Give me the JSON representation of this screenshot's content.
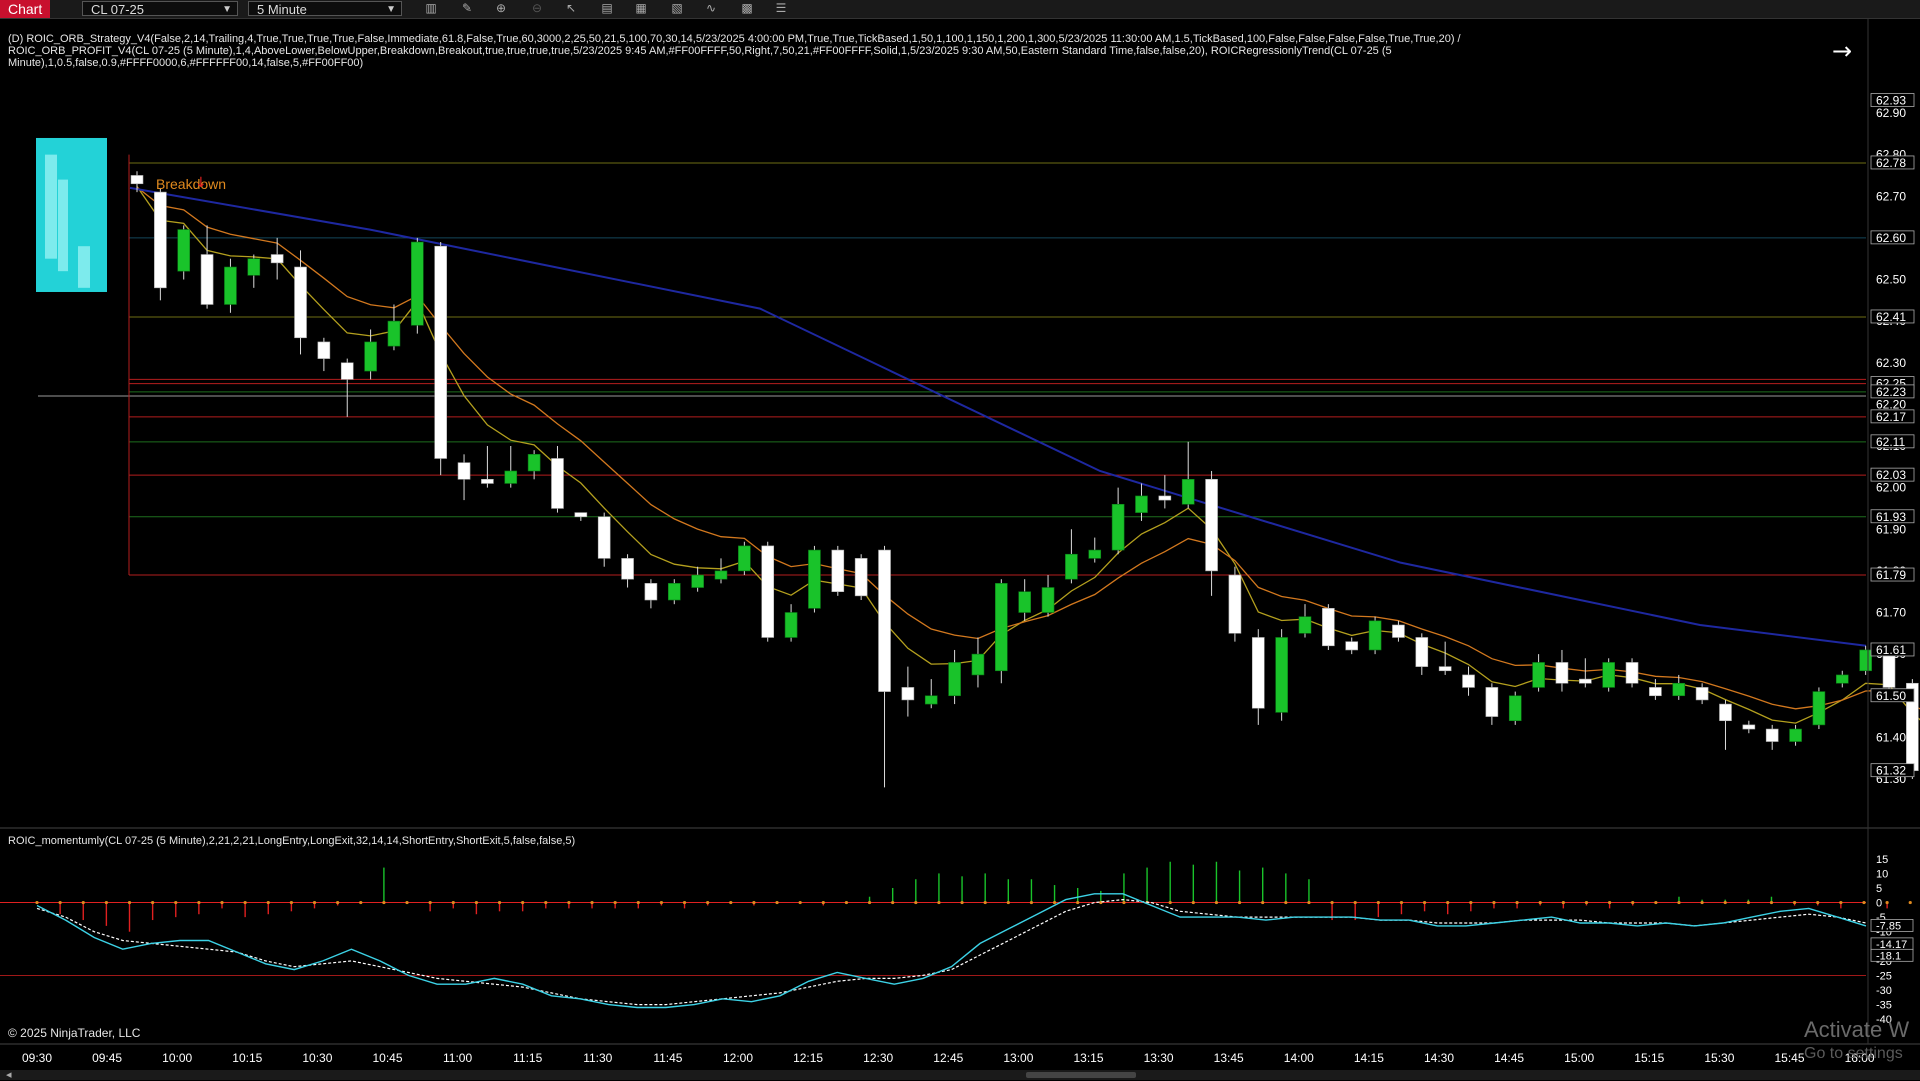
{
  "toolbar": {
    "chart_tab": "Chart",
    "instrument": "CL 07-25",
    "interval": "5 Minute",
    "icons": [
      "bar-style-icon",
      "draw-pencil-icon",
      "zoom-in-icon",
      "zoom-out-icon",
      "pointer-icon",
      "properties-icon",
      "data-box-icon",
      "strategies-icon",
      "indicators-icon",
      "templates-icon"
    ]
  },
  "header": {
    "strategy_line1": "(D) ROIC_ORB_Strategy_V4(False,2,14,Trailing,4,True,True,True,True,False,Immediate,61.8,False,True,60,3000,2,25,50,21,5,100,70,30,14,5/23/2025 4:00:00 PM,True,True,TickBased,1,50,1,100,1,150,1,200,1,300,5/23/2025 11:30:00 AM,1.5,TickBased,100,False,False,False,False,True,True,20) /",
    "strategy_line2": "ROIC_ORB_PROFIT_V4(CL 07-25 (5 Minute),1,4,AboveLower,BelowUpper,Breakdown,Breakout,true,true,true,true,5/23/2025 9:45 AM,#FF00FFFF,50,Right,7,50,21,#FF00FFFF,Solid,1,5/23/2025 9:30 AM,50,Eastern Standard Time,false,false,20), ROICRegressionlyTrend(CL 07-25 (5",
    "strategy_line3": "Minute),1,0.5,false,0.9,#FFFF0000,6,#FFFFFF00,14,false,5,#FF00FF00)",
    "breakdown_label": "Breakdown",
    "indicator_label": "ROIC_momentumly(CL 07-25 (5 Minute),2,21,2,21,LongEntry,LongExit,32,14,14,ShortEntry,ShortExit,5,false,false,5)",
    "copyright": "© 2025 NinjaTrader, LLC",
    "watermark_line1": "Activate W",
    "watermark_line2": "Go to settings"
  },
  "colors": {
    "up_candle": "#19c32a",
    "down_candle": "#ffffff",
    "ema_fast": "#b4a01e",
    "ema_slow": "#d2781e",
    "trend": "#1e28a0",
    "cyan_box": "#23d2d7",
    "red_line": "#b41e1e",
    "green_line": "#1e6e1e",
    "yellow_line": "#6e6e14",
    "osc_fast": "#3cd2e6",
    "osc_slow": "#ffffff"
  },
  "chart_data": {
    "type": "candlestick",
    "instrument": "CL 07-25 (5 Minute)",
    "price_axis_ticks": [
      "62.90",
      "62.80",
      "62.70",
      "62.60",
      "62.50",
      "62.40",
      "62.30",
      "62.20",
      "62.10",
      "62.00",
      "61.90",
      "61.80",
      "61.70",
      "61.60",
      "61.50",
      "61.40",
      "61.30"
    ],
    "price_badges": [
      {
        "label": "62.93",
        "color": "#ffffff"
      },
      {
        "label": "62.78",
        "color": "#ffffff"
      },
      {
        "label": "62.60",
        "color": "#ffffff"
      },
      {
        "label": "62.41",
        "color": "#ffffff"
      },
      {
        "label": "62.25",
        "color": "#ffffff"
      },
      {
        "label": "62.23",
        "color": "#ffffff"
      },
      {
        "label": "62.17",
        "color": "#ffffff"
      },
      {
        "label": "62.11",
        "color": "#ffffff"
      },
      {
        "label": "62.03",
        "color": "#ffffff"
      },
      {
        "label": "61.93",
        "color": "#ffffff"
      },
      {
        "label": "61.79",
        "color": "#ffffff"
      },
      {
        "label": "61.61",
        "color": "#ffffff"
      },
      {
        "label": "61.50",
        "color": "#ffffff"
      },
      {
        "label": "61.32",
        "color": "#ffffff"
      }
    ],
    "levels": [
      {
        "price": 62.78,
        "color": "#6e6e14"
      },
      {
        "price": 62.6,
        "color": "#14465a"
      },
      {
        "price": 62.41,
        "color": "#6e6e14"
      },
      {
        "price": 62.26,
        "color": "#b41e1e"
      },
      {
        "price": 62.25,
        "color": "#b41e1e"
      },
      {
        "price": 62.23,
        "color": "#1e6e1e"
      },
      {
        "price": 62.17,
        "color": "#b41e1e"
      },
      {
        "price": 62.11,
        "color": "#1e6e1e"
      },
      {
        "price": 62.03,
        "color": "#b41e1e"
      },
      {
        "price": 61.93,
        "color": "#1e6e1e"
      },
      {
        "price": 61.79,
        "color": "#b41e1e"
      }
    ],
    "time_labels": [
      "09:30",
      "09:45",
      "10:00",
      "10:15",
      "10:30",
      "10:45",
      "11:00",
      "11:15",
      "11:30",
      "11:45",
      "12:00",
      "12:15",
      "12:30",
      "12:45",
      "13:00",
      "13:15",
      "13:30",
      "13:45",
      "14:00",
      "14:15",
      "14:30",
      "14:45",
      "15:00",
      "15:15",
      "15:30",
      "15:45",
      "16:00"
    ],
    "candles": [
      [
        62.75,
        62.73,
        62.76,
        62.71
      ],
      [
        62.71,
        62.48,
        62.72,
        62.45
      ],
      [
        62.52,
        62.62,
        62.63,
        62.5
      ],
      [
        62.56,
        62.44,
        62.63,
        62.43
      ],
      [
        62.44,
        62.53,
        62.55,
        62.42
      ],
      [
        62.51,
        62.55,
        62.56,
        62.48
      ],
      [
        62.56,
        62.54,
        62.6,
        62.5
      ],
      [
        62.53,
        62.36,
        62.57,
        62.32
      ],
      [
        62.35,
        62.31,
        62.36,
        62.28
      ],
      [
        62.3,
        62.26,
        62.31,
        62.17
      ],
      [
        62.28,
        62.35,
        62.38,
        62.26
      ],
      [
        62.34,
        62.4,
        62.44,
        62.33
      ],
      [
        62.39,
        62.59,
        62.6,
        62.37
      ],
      [
        62.58,
        62.07,
        62.59,
        62.03
      ],
      [
        62.06,
        62.02,
        62.08,
        61.97
      ],
      [
        62.02,
        62.01,
        62.1,
        62.0
      ],
      [
        62.01,
        62.04,
        62.1,
        62.0
      ],
      [
        62.04,
        62.08,
        62.09,
        62.02
      ],
      [
        62.07,
        61.95,
        62.1,
        61.94
      ],
      [
        61.94,
        61.93,
        61.94,
        61.92
      ],
      [
        61.93,
        61.83,
        61.94,
        61.81
      ],
      [
        61.83,
        61.78,
        61.84,
        61.76
      ],
      [
        61.77,
        61.73,
        61.78,
        61.71
      ],
      [
        61.73,
        61.77,
        61.78,
        61.72
      ],
      [
        61.76,
        61.79,
        61.81,
        61.75
      ],
      [
        61.78,
        61.8,
        61.83,
        61.77
      ],
      [
        61.8,
        61.86,
        61.87,
        61.79
      ],
      [
        61.86,
        61.64,
        61.87,
        61.63
      ],
      [
        61.64,
        61.7,
        61.72,
        61.63
      ],
      [
        61.71,
        61.85,
        61.86,
        61.7
      ],
      [
        61.85,
        61.75,
        61.86,
        61.74
      ],
      [
        61.83,
        61.74,
        61.84,
        61.73
      ],
      [
        61.85,
        61.51,
        61.86,
        61.28
      ],
      [
        61.52,
        61.49,
        61.57,
        61.45
      ],
      [
        61.48,
        61.5,
        61.54,
        61.47
      ],
      [
        61.5,
        61.58,
        61.61,
        61.48
      ],
      [
        61.55,
        61.6,
        61.64,
        61.52
      ],
      [
        61.56,
        61.77,
        61.78,
        61.53
      ],
      [
        61.7,
        61.75,
        61.78,
        61.68
      ],
      [
        61.7,
        61.76,
        61.79,
        61.69
      ],
      [
        61.78,
        61.84,
        61.9,
        61.77
      ],
      [
        61.83,
        61.85,
        61.88,
        61.82
      ],
      [
        61.85,
        61.96,
        62.0,
        61.84
      ],
      [
        61.94,
        61.98,
        62.01,
        61.92
      ],
      [
        61.98,
        61.97,
        62.03,
        61.95
      ],
      [
        61.96,
        62.02,
        62.11,
        61.95
      ],
      [
        62.02,
        61.8,
        62.04,
        61.74
      ],
      [
        61.79,
        61.65,
        61.81,
        61.63
      ],
      [
        61.64,
        61.47,
        61.66,
        61.43
      ],
      [
        61.46,
        61.64,
        61.66,
        61.44
      ],
      [
        61.65,
        61.69,
        61.72,
        61.64
      ],
      [
        61.71,
        61.62,
        61.72,
        61.61
      ],
      [
        61.63,
        61.61,
        61.64,
        61.6
      ],
      [
        61.61,
        61.68,
        61.69,
        61.6
      ],
      [
        61.67,
        61.64,
        61.68,
        61.63
      ],
      [
        61.64,
        61.57,
        61.65,
        61.55
      ],
      [
        61.57,
        61.56,
        61.63,
        61.55
      ],
      [
        61.55,
        61.52,
        61.57,
        61.5
      ],
      [
        61.52,
        61.45,
        61.53,
        61.43
      ],
      [
        61.44,
        61.5,
        61.51,
        61.43
      ],
      [
        61.52,
        61.58,
        61.6,
        61.51
      ],
      [
        61.58,
        61.53,
        61.61,
        61.51
      ],
      [
        61.54,
        61.53,
        61.59,
        61.52
      ],
      [
        61.52,
        61.58,
        61.59,
        61.51
      ],
      [
        61.58,
        61.53,
        61.59,
        61.52
      ],
      [
        61.52,
        61.5,
        61.54,
        61.49
      ],
      [
        61.5,
        61.53,
        61.55,
        61.49
      ],
      [
        61.52,
        61.49,
        61.53,
        61.48
      ],
      [
        61.48,
        61.44,
        61.49,
        61.37
      ],
      [
        61.43,
        61.42,
        61.44,
        61.41
      ],
      [
        61.42,
        61.39,
        61.43,
        61.37
      ],
      [
        61.39,
        61.42,
        61.43,
        61.38
      ],
      [
        61.43,
        61.51,
        61.52,
        61.42
      ],
      [
        61.53,
        61.55,
        61.56,
        61.52
      ],
      [
        61.56,
        61.61,
        61.62,
        61.55
      ],
      [
        61.61,
        61.52,
        61.62,
        61.51
      ],
      [
        61.53,
        61.32,
        61.54,
        61.3
      ],
      [
        61.32,
        61.32,
        61.34,
        61.31
      ]
    ],
    "oscillator": {
      "axis_labels": [
        "15",
        "10",
        "5",
        "0",
        "-5",
        "-10",
        "-15",
        "-20",
        "-25",
        "-30",
        "-35",
        "-40"
      ],
      "badges": [
        "-7.85",
        "-14.17",
        "-18.1"
      ],
      "histogram": [
        0,
        -4,
        -6,
        -8,
        -10,
        -6,
        -5,
        -4,
        -2,
        -5,
        -4,
        -3,
        -2,
        -1,
        0,
        12,
        0,
        -3,
        -2,
        -4,
        -3,
        -3,
        -2,
        -2,
        -2,
        -2,
        -2,
        -1,
        -2,
        -1,
        0,
        -1,
        0,
        0,
        -1,
        0,
        2,
        5,
        8,
        10,
        9,
        10,
        8,
        8,
        6,
        5,
        4,
        10,
        12,
        14,
        13,
        14,
        11,
        12,
        10,
        8,
        -6,
        -6,
        -5,
        -4,
        -3,
        -4,
        -3,
        -2,
        -2,
        -1,
        -2,
        -1,
        -2,
        -1,
        0,
        2,
        1,
        1,
        1,
        2,
        -1,
        -1,
        -2,
        0,
        -2,
        0,
        -1,
        -2,
        0,
        4,
        6,
        8,
        5,
        2,
        -3,
        -5
      ],
      "fast_line": [
        -1,
        -6,
        -12,
        -16,
        -14,
        -13,
        -13,
        -17,
        -21,
        -23,
        -20,
        -16,
        -20,
        -25,
        -28,
        -28,
        -26,
        -28,
        -32,
        -33,
        -35,
        -36,
        -36,
        -35,
        -33,
        -34,
        -32,
        -27,
        -24,
        -26,
        -28,
        -26,
        -22,
        -14,
        -9,
        -4,
        1,
        3,
        3,
        -1,
        -5,
        -5,
        -5,
        -6,
        -5,
        -5,
        -5,
        -6,
        -6,
        -8,
        -8,
        -7,
        -6,
        -5,
        -7,
        -7,
        -8,
        -7,
        -8,
        -7,
        -5,
        -3,
        -2,
        -5,
        -8
      ],
      "slow_line": [
        -2,
        -5,
        -10,
        -13,
        -14,
        -15,
        -16,
        -17,
        -20,
        -22,
        -21,
        -20,
        -22,
        -24,
        -26,
        -27,
        -28,
        -29,
        -31,
        -33,
        -34,
        -35,
        -35,
        -34,
        -33,
        -32,
        -31,
        -29,
        -27,
        -26,
        -26,
        -25,
        -23,
        -18,
        -13,
        -8,
        -3,
        0,
        1,
        0,
        -3,
        -4,
        -5,
        -5,
        -5,
        -5,
        -5,
        -6,
        -6,
        -7,
        -7,
        -7,
        -6,
        -6,
        -6,
        -7,
        -7,
        -7,
        -8,
        -7,
        -6,
        -5,
        -4,
        -5,
        -7
      ]
    }
  }
}
